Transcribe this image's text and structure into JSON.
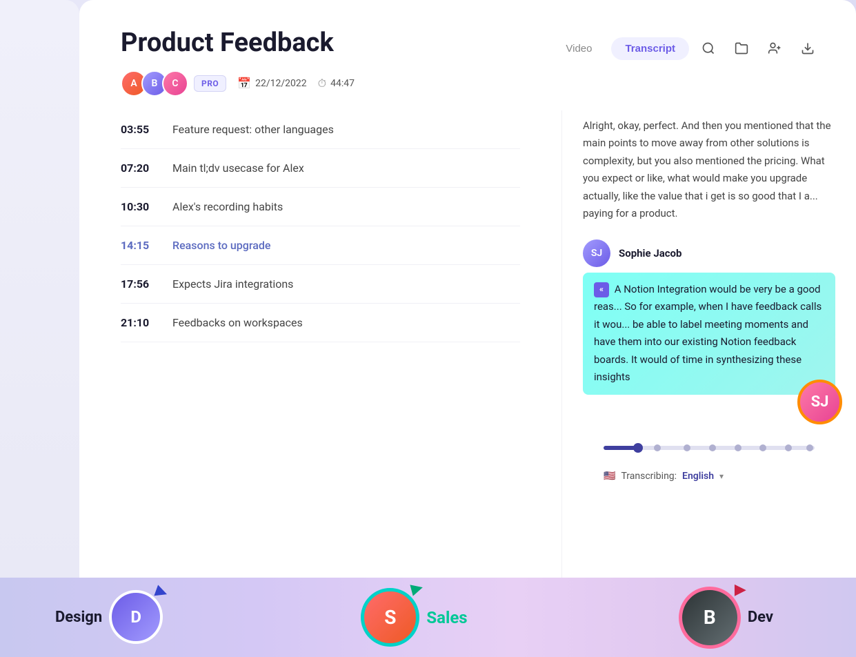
{
  "page": {
    "title": "Product Feedback",
    "bg_color": "#e8e8f5"
  },
  "header": {
    "title": "Product Feedback",
    "badge": "PRO",
    "date": "22/12/2022",
    "duration": "44:47",
    "tabs": [
      {
        "label": "Video",
        "active": false
      },
      {
        "label": "Transcript",
        "active": true
      }
    ],
    "icons": [
      "search",
      "folder",
      "add-user",
      "download"
    ]
  },
  "chapters": [
    {
      "time": "03:55",
      "title": "Feature request: other languages",
      "highlight": false
    },
    {
      "time": "07:20",
      "title": "Main tl;dv usecase for Alex",
      "highlight": false
    },
    {
      "time": "10:30",
      "title": "Alex's recording habits",
      "highlight": false
    },
    {
      "time": "14:15",
      "title": "Reasons to upgrade",
      "highlight": true
    },
    {
      "time": "17:56",
      "title": "Expects Jira integrations",
      "highlight": false
    },
    {
      "time": "21:10",
      "title": "Feedbacks on workspaces",
      "highlight": false
    }
  ],
  "transcript": {
    "paragraph1": "Alright, okay, perfect. And then you mentioned that the main points to move away from other solutions is complexity, but you also mentioned the pricing. What you expect or like, what would make you upgrade actually, like the value that i get is so good that I a... paying for a product.",
    "speaker": "Sophie Jacob",
    "highlighted_text": "A Notion Integration would be very be a good reas... So for example, when I have feedback calls it wou... be able to label meeting moments and have them into our existing Notion feedback boards. It would of time in synthesizing these insights",
    "language_label": "Transcribing:",
    "language": "English"
  },
  "progress": {
    "fill_pct": 15,
    "dots": [
      14,
      25,
      38,
      50,
      60,
      72,
      85,
      95
    ]
  },
  "bottom": {
    "personas": [
      {
        "label": "Design",
        "color": "dark"
      },
      {
        "label": "Sales",
        "color": "green"
      },
      {
        "label": "Dev",
        "color": "dark"
      }
    ]
  }
}
